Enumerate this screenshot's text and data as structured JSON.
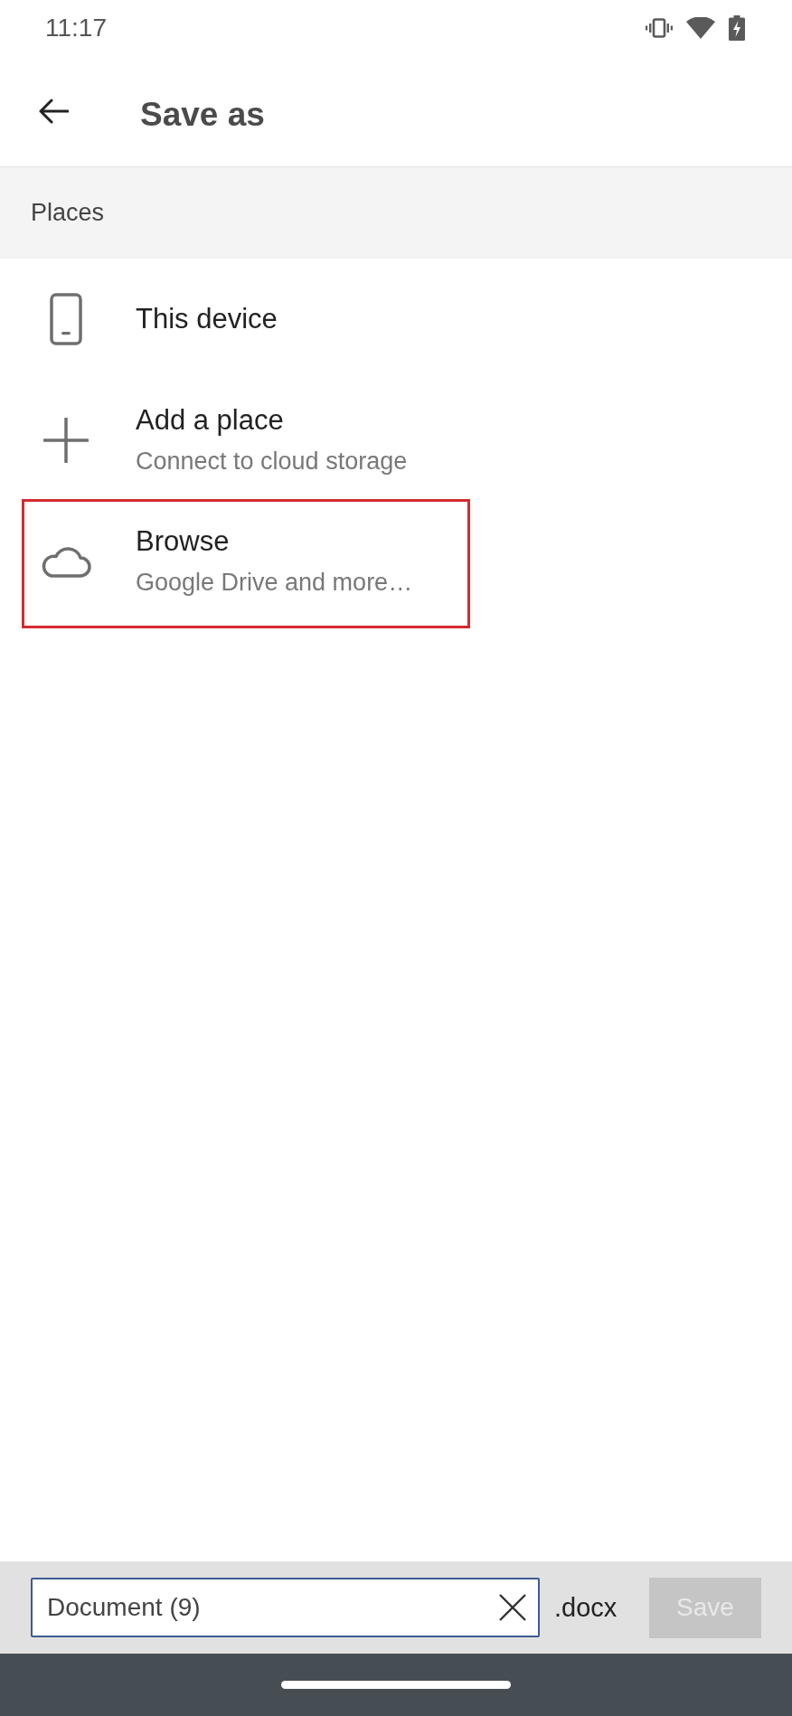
{
  "status_bar": {
    "time": "11:17"
  },
  "header": {
    "title": "Save as"
  },
  "sections": [
    {
      "title": "Places",
      "items": [
        {
          "kind": "device",
          "title": "This device",
          "highlighted": false
        },
        {
          "kind": "add",
          "title": "Add a place",
          "subtitle": "Connect to cloud storage",
          "highlighted": false
        },
        {
          "kind": "cloud",
          "title": "Browse",
          "subtitle": "Google Drive and more…",
          "highlighted": true
        }
      ]
    }
  ],
  "save_bar": {
    "file_name": {
      "value": "Document (9)"
    },
    "extension": ".docx",
    "save_button": {
      "label": "Save",
      "disabled": true
    }
  }
}
